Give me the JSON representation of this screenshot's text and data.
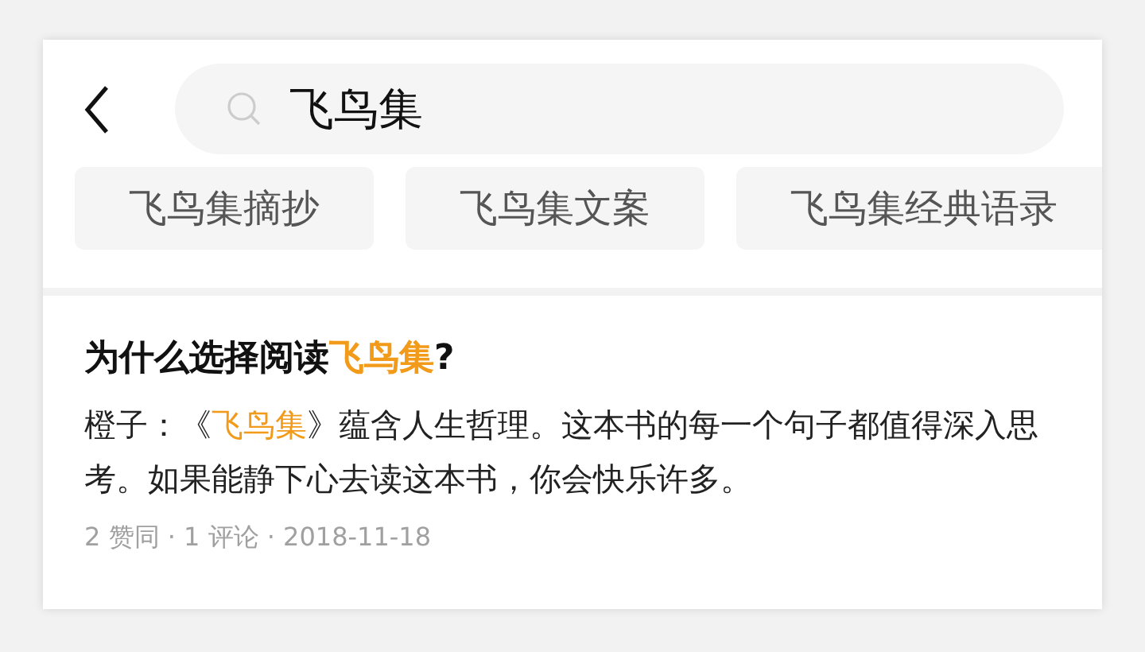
{
  "search": {
    "value": "飞鸟集"
  },
  "suggestions": [
    {
      "label": "飞鸟集摘抄"
    },
    {
      "label": "飞鸟集文案"
    },
    {
      "label": "飞鸟集经典语录"
    }
  ],
  "result": {
    "title": [
      {
        "text": "为什么选择阅读",
        "highlighted": false
      },
      {
        "text": "飞鸟集",
        "highlighted": true
      },
      {
        "text": "?",
        "highlighted": false
      }
    ],
    "snippet": [
      {
        "text": "橙子：《",
        "highlighted": false
      },
      {
        "text": "飞鸟集",
        "highlighted": true
      },
      {
        "text": "》蕴含人生哲理。这本书的每一个句子都值得深入思考。如果能静下心去读这本书，你会快乐许多。",
        "highlighted": false
      }
    ],
    "meta": "2 赞同 · 1 评论 · 2018-11-18"
  }
}
